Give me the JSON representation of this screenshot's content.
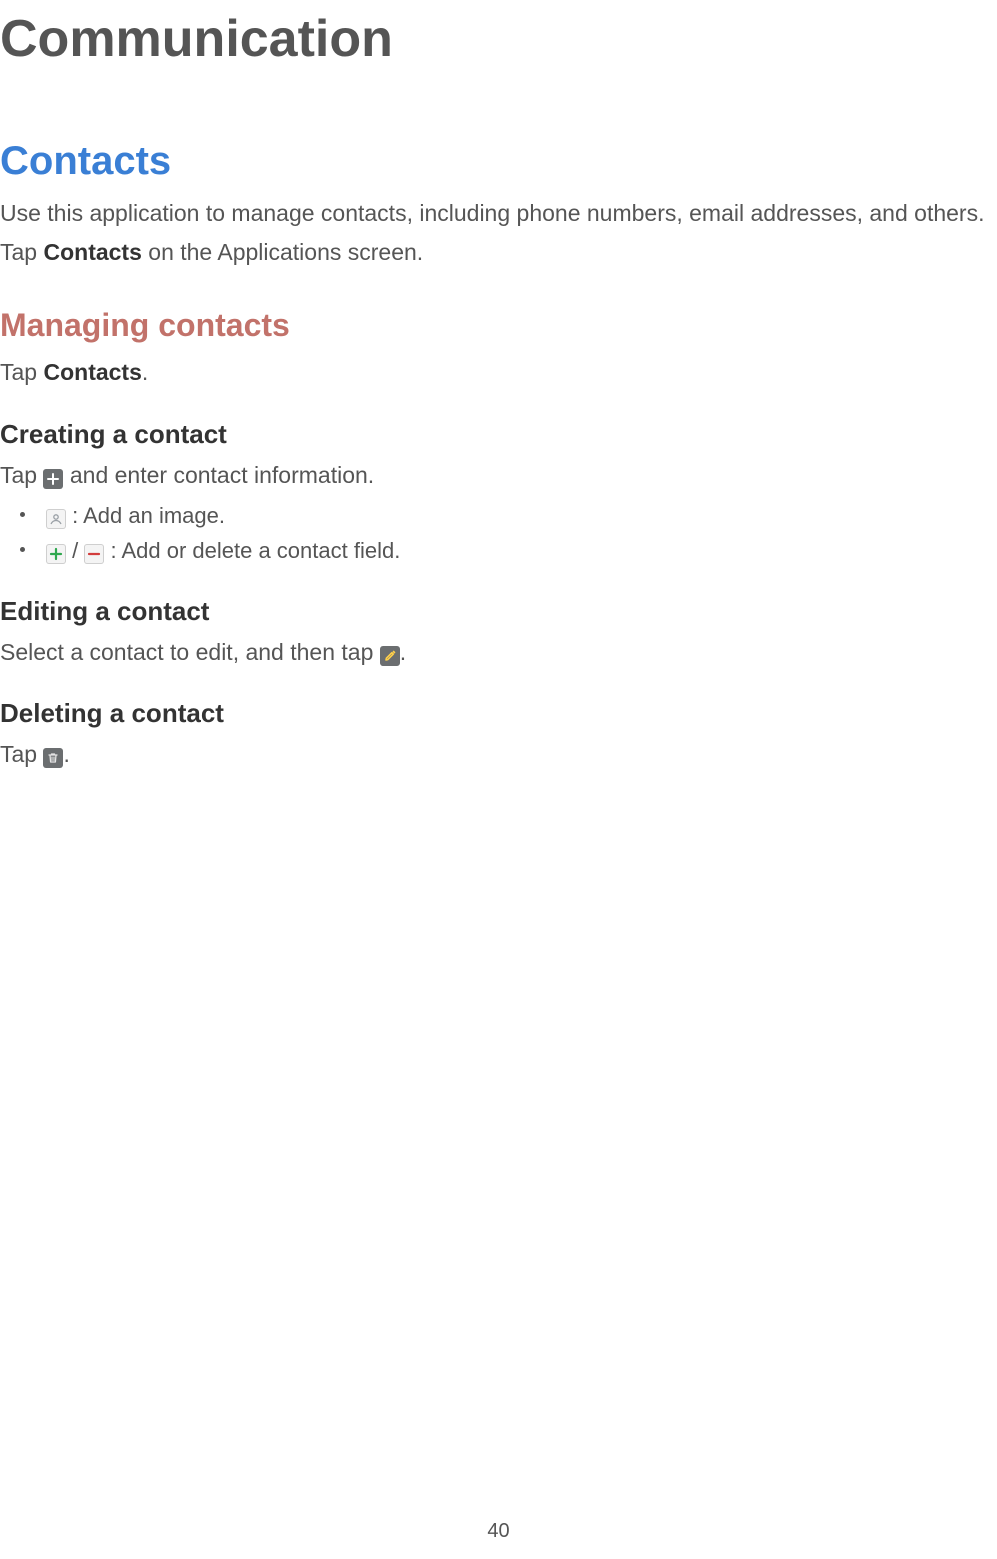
{
  "chapter_title": "Communication",
  "section": {
    "title": "Contacts",
    "intro": "Use this application to manage contacts, including phone numbers, email addresses, and others.",
    "tap_line_pre": "Tap ",
    "tap_line_strong": "Contacts",
    "tap_line_post": " on the Applications screen."
  },
  "managing": {
    "title": "Managing contacts",
    "tap_line_pre": "Tap ",
    "tap_line_strong": "Contacts",
    "tap_line_post": "."
  },
  "creating": {
    "title": "Creating a contact",
    "line_pre": "Tap ",
    "line_post": " and enter contact information.",
    "bullet_image": " : Add an image.",
    "bullet_field_sep": " / ",
    "bullet_field_post": " : Add or delete a contact field."
  },
  "editing": {
    "title": "Editing a contact",
    "line_pre": "Select a contact to edit, and then tap ",
    "line_post": "."
  },
  "deleting": {
    "title": "Deleting a contact",
    "line_pre": "Tap ",
    "line_post": "."
  },
  "page_number": "40"
}
